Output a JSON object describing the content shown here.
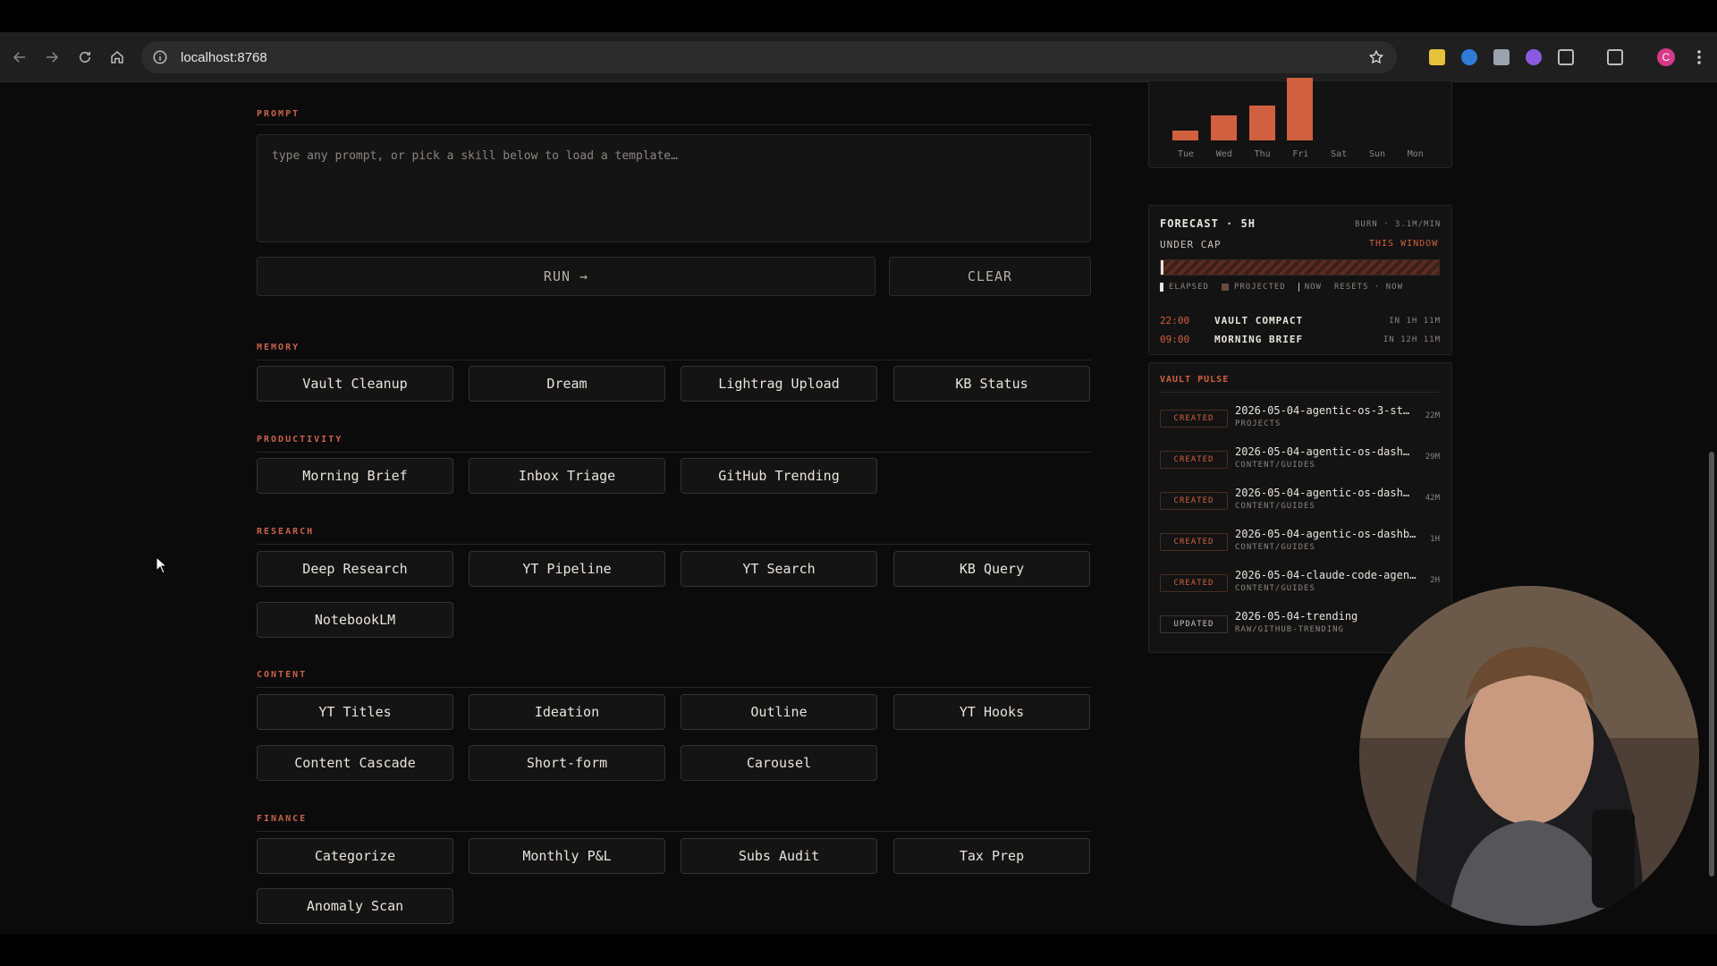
{
  "browser": {
    "url": "localhost:8768",
    "profile_initial": "C"
  },
  "prompt": {
    "label": "PROMPT",
    "placeholder": "type any prompt, or pick a skill below to load a template…",
    "run_label": "RUN →",
    "clear_label": "CLEAR"
  },
  "sections": [
    {
      "label": "MEMORY",
      "skills": [
        "Vault Cleanup",
        "Dream",
        "Lightrag Upload",
        "KB Status"
      ]
    },
    {
      "label": "PRODUCTIVITY",
      "skills": [
        "Morning Brief",
        "Inbox Triage",
        "GitHub Trending"
      ]
    },
    {
      "label": "RESEARCH",
      "skills": [
        "Deep Research",
        "YT Pipeline",
        "YT Search",
        "KB Query",
        "NotebookLM"
      ]
    },
    {
      "label": "CONTENT",
      "skills": [
        "YT Titles",
        "Ideation",
        "Outline",
        "YT Hooks",
        "Content Cascade",
        "Short-form",
        "Carousel"
      ]
    },
    {
      "label": "FINANCE",
      "skills": [
        "Categorize",
        "Monthly P&L",
        "Subs Audit",
        "Tax Prep",
        "Anomaly Scan"
      ]
    }
  ],
  "usage_chart": {
    "days": [
      "Tue",
      "Wed",
      "Thu",
      "Fri",
      "Sat",
      "Sun",
      "Mon"
    ],
    "values": [
      0.15,
      0.4,
      0.55,
      1.0,
      0,
      0,
      0
    ],
    "bar_color": "#d0603f"
  },
  "forecast": {
    "title": "FORECAST · 5H",
    "burn": "BURN · 3.1M/MIN",
    "status": "UNDER CAP",
    "window": "THIS WINDOW",
    "elapsed_fraction": 0.01,
    "legend": {
      "elapsed": "ELAPSED",
      "projected": "PROJECTED",
      "now": "NOW",
      "resets": "RESETS · NOW"
    },
    "schedule": [
      {
        "time": "22:00",
        "name": "VAULT COMPACT",
        "when": "IN 1H 11M"
      },
      {
        "time": "09:00",
        "name": "MORNING BRIEF",
        "when": "IN 12H 11M"
      }
    ]
  },
  "vault_pulse": {
    "title": "VAULT PULSE",
    "items": [
      {
        "status": "CREATED",
        "name": "2026-05-04-agentic-os-3-st…",
        "path": "PROJECTS",
        "age": "22M"
      },
      {
        "status": "CREATED",
        "name": "2026-05-04-agentic-os-dash…",
        "path": "CONTENT/GUIDES",
        "age": "29M"
      },
      {
        "status": "CREATED",
        "name": "2026-05-04-agentic-os-dash…",
        "path": "CONTENT/GUIDES",
        "age": "42M"
      },
      {
        "status": "CREATED",
        "name": "2026-05-04-agentic-os-dashb…",
        "path": "CONTENT/GUIDES",
        "age": "1H"
      },
      {
        "status": "CREATED",
        "name": "2026-05-04-claude-code-agen…",
        "path": "CONTENT/GUIDES",
        "age": "2H"
      },
      {
        "status": "UPDATED",
        "name": "2026-05-04-trending",
        "path": "RAW/GITHUB-TRENDING",
        "age": ""
      }
    ]
  },
  "colors": {
    "accent": "#d0603f",
    "background": "#0b0b0b",
    "panel": "#131313"
  }
}
